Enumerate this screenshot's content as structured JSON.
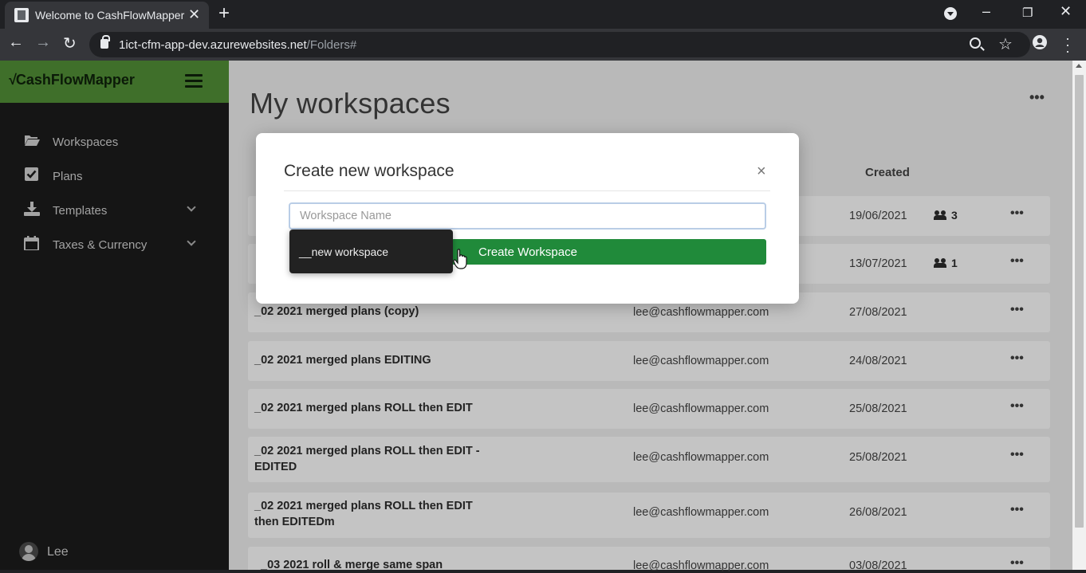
{
  "browser": {
    "tab_title": "Welcome to CashFlowMapper",
    "url_host": "1ict-cfm-app-dev.azurewebsites.net",
    "url_path": "/Folders#"
  },
  "app": {
    "brand": "CashFlowMapper",
    "nav": [
      {
        "label": "Workspaces",
        "icon": "folder-open-icon"
      },
      {
        "label": "Plans",
        "icon": "checkbox-icon"
      },
      {
        "label": "Templates",
        "icon": "download-icon",
        "expandable": true
      },
      {
        "label": "Taxes & Currency",
        "icon": "calendar-icon",
        "expandable": true
      }
    ],
    "user": "Lee"
  },
  "main": {
    "title": "My workspaces",
    "page_menu": "•••",
    "columns": {
      "created": "Created"
    },
    "rows": [
      {
        "name": "",
        "owner": "",
        "date": "19/06/2021",
        "shared": "3"
      },
      {
        "name": "",
        "owner": "",
        "date": "13/07/2021",
        "shared": "1"
      },
      {
        "name": "_02 2021 merged plans (copy)",
        "owner": "lee@cashflowmapper.com",
        "date": "27/08/2021",
        "shared": ""
      },
      {
        "name": "_02 2021 merged plans EDITING",
        "owner": "lee@cashflowmapper.com",
        "date": "24/08/2021",
        "shared": ""
      },
      {
        "name": "_02 2021 merged plans ROLL then EDIT",
        "owner": "lee@cashflowmapper.com",
        "date": "25/08/2021",
        "shared": ""
      },
      {
        "name": "_02 2021 merged plans ROLL then EDIT - EDITED",
        "owner": "lee@cashflowmapper.com",
        "date": "25/08/2021",
        "shared": ""
      },
      {
        "name": "_02 2021 merged plans ROLL then EDIT then EDITEDm",
        "owner": "lee@cashflowmapper.com",
        "date": "26/08/2021",
        "shared": ""
      },
      {
        "name": "_03 2021 roll & merge same span",
        "owner": "lee@cashflowmapper.com",
        "date": "03/08/2021",
        "shared": ""
      }
    ],
    "row_menu": "•••"
  },
  "modal": {
    "title": "Create new workspace",
    "close": "×",
    "input_placeholder": "Workspace Name",
    "input_value": "",
    "suggestion": "__new workspace",
    "submit_label": "Create Workspace"
  },
  "colors": {
    "brand_green": "#3f6f2a",
    "button_green": "#208a3a",
    "sidebar_bg": "#151515"
  }
}
